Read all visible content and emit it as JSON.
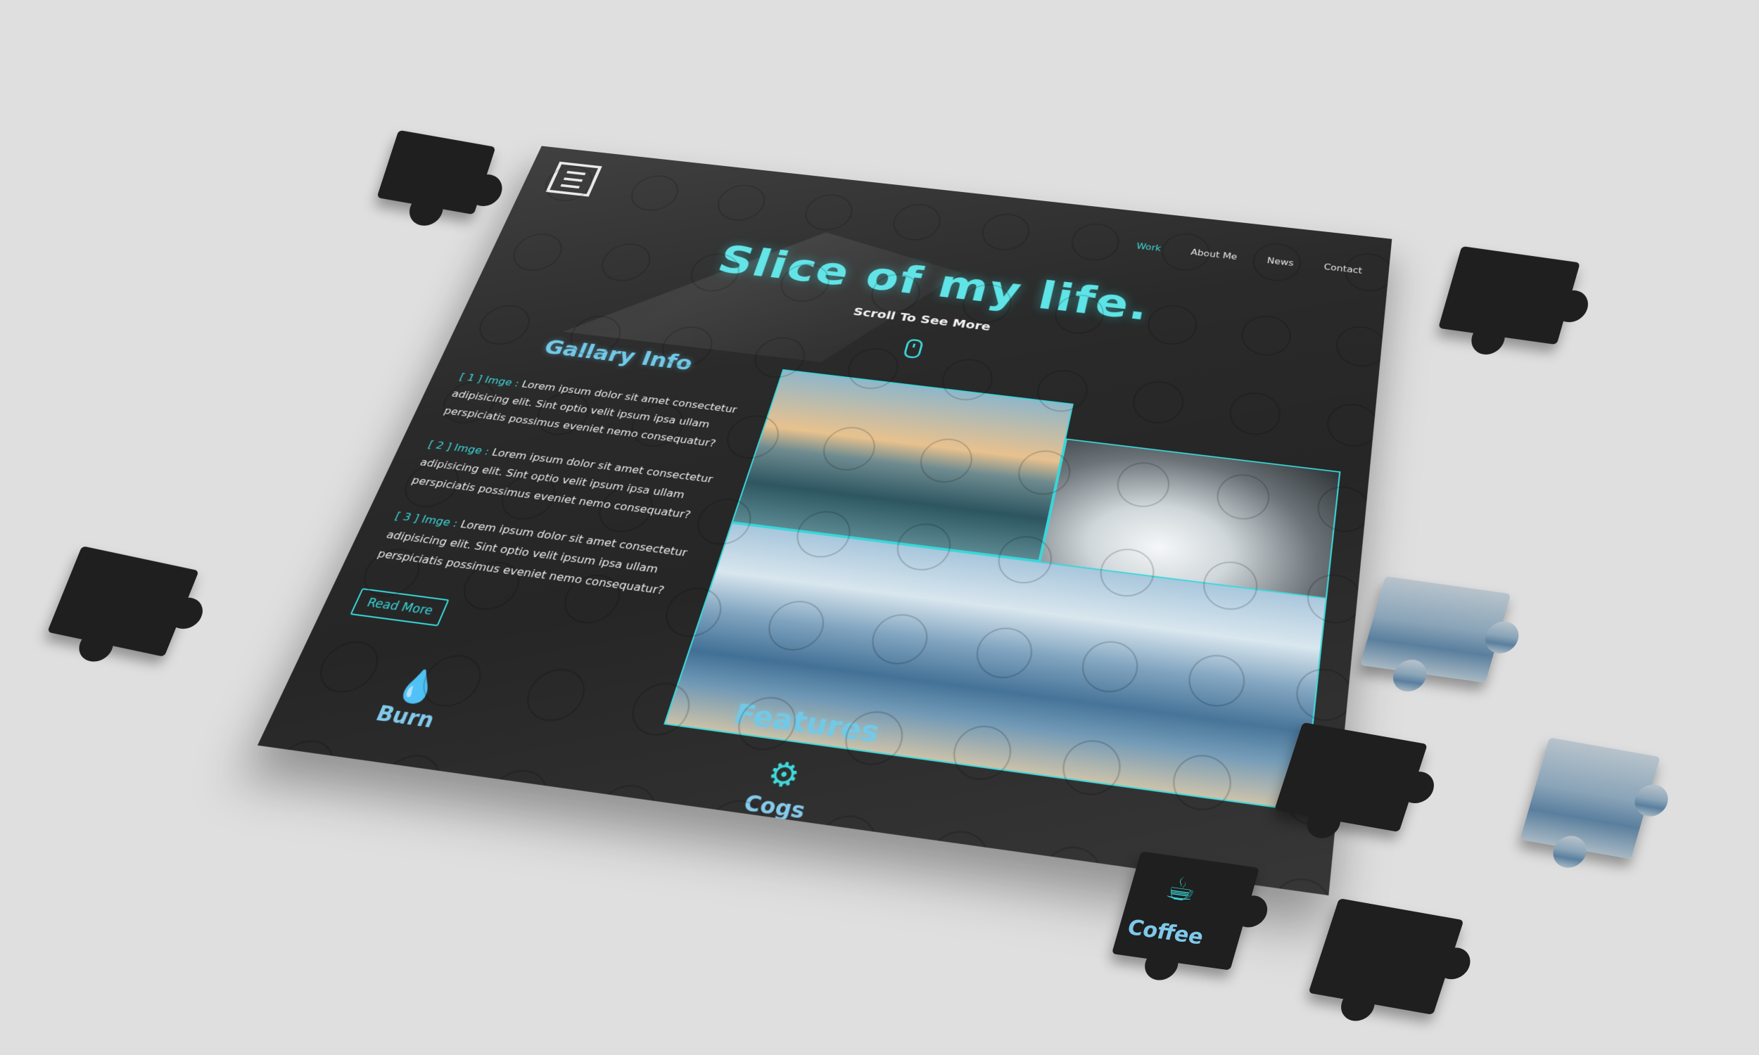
{
  "brand": {
    "logo_icon": "e-logo-icon"
  },
  "nav": {
    "items": [
      {
        "label": "Work",
        "active": true
      },
      {
        "label": "About Me",
        "active": false
      },
      {
        "label": "News",
        "active": false
      },
      {
        "label": "Contact",
        "active": false
      }
    ]
  },
  "hero": {
    "title": "Slice of my life.",
    "subtitle": "Scroll To See More",
    "scroll_icon": "mouse-icon"
  },
  "gallery_info": {
    "title": "Gallary Info",
    "items": [
      {
        "label": "[ 1 ] Imge :",
        "text": "Lorem ipsum dolor sit amet consectetur adipisicing elit. Sint optio velit ipsum ipsa ullam perspiciatis possimus eveniet nemo consequatur?"
      },
      {
        "label": "[ 2 ] Imge :",
        "text": "Lorem ipsum dolor sit amet consectetur adipisicing elit. Sint optio velit ipsum ipsa ullam perspiciatis possimus eveniet nemo consequatur?"
      },
      {
        "label": "[ 3 ] Imge :",
        "text": "Lorem ipsum dolor sit amet consectetur adipisicing elit. Sint optio velit ipsum ipsa ullam perspiciatis possimus eveniet nemo consequatur?"
      }
    ],
    "button": "Read More"
  },
  "features": {
    "title": "Features",
    "items": [
      {
        "label": "Burn",
        "icon": "flame-icon"
      },
      {
        "label": "Cogs",
        "icon": "cogs-icon"
      },
      {
        "label": "Coffee",
        "icon": "coffee-icon"
      }
    ]
  },
  "colors": {
    "accent": "#38d7da",
    "heading": "#6ec7e6",
    "board": "#262626",
    "background": "#dfdfdf"
  }
}
